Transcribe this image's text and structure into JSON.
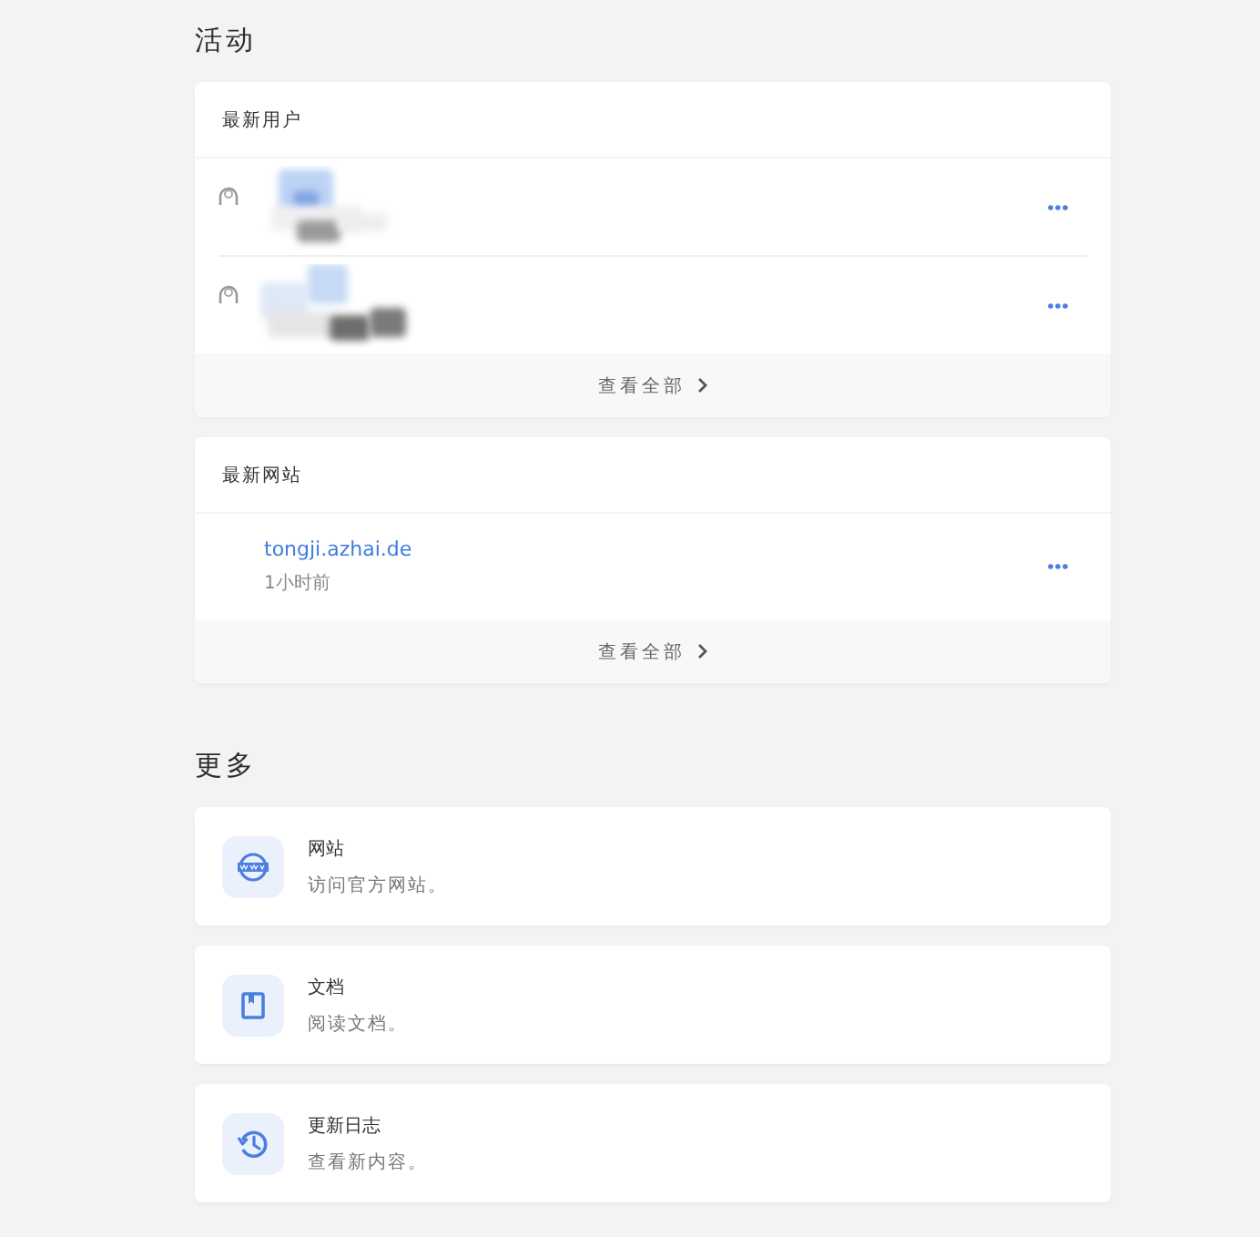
{
  "activity": {
    "title": "活动",
    "cards": [
      {
        "title": "最新用户",
        "rows": [
          {
            "kind": "redacted"
          },
          {
            "kind": "redacted"
          }
        ],
        "footer": "查看全部"
      },
      {
        "title": "最新网站",
        "rows": [
          {
            "kind": "site",
            "url": "tongji.azhai.de",
            "time": "1小时前"
          }
        ],
        "footer": "查看全部"
      }
    ]
  },
  "more": {
    "title": "更多",
    "items": [
      {
        "kind": "web",
        "title": "网站",
        "subtitle": "访问官方网站。"
      },
      {
        "kind": "docs",
        "title": "文档",
        "subtitle": "阅读文档。"
      },
      {
        "kind": "log",
        "title": "更新日志",
        "subtitle": "查看新内容。"
      }
    ]
  }
}
